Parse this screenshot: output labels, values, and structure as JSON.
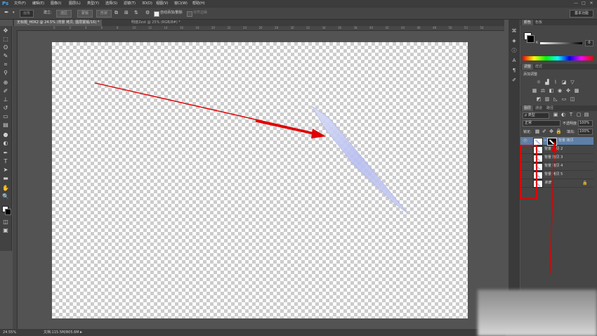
{
  "app": {
    "logo": "Ps"
  },
  "menu": [
    "文件(F)",
    "编辑(E)",
    "图像(I)",
    "图层(L)",
    "类型(Y)",
    "选择(S)",
    "滤镜(T)",
    "3D(D)",
    "视图(V)",
    "窗口(W)",
    "帮助(H)"
  ],
  "window_controls": [
    "—",
    "□",
    "✕"
  ],
  "options": {
    "value_box": "画板",
    "align_label": "建立:",
    "btn_selection": "选区",
    "btn_mask": "蒙版",
    "btn_shape": "形状",
    "auto_add_delete": "自动添加/删除",
    "align_edges": "对齐边缘",
    "workspace": "基本功能"
  },
  "document": {
    "tab_active": "无标题_H0K2 @ 24.5% (背景 拷贝, 图层蒙版/16) *",
    "tab_inactive": "明度Zest @ 25% (RGB/8#) *",
    "ruler_ticks": [
      "0",
      "2",
      "4",
      "6",
      "8",
      "10",
      "12",
      "14",
      "16",
      "18",
      "20",
      "22",
      "24",
      "26",
      "28",
      "30",
      "32",
      "34",
      "36",
      "38",
      "40",
      "42",
      "44",
      "46",
      "48",
      "50",
      "52",
      "54"
    ]
  },
  "status": {
    "zoom": "24.55%",
    "doc_info": "文档:115.5M/805.6M"
  },
  "color_panel": {
    "tabs": [
      "颜色",
      "色板"
    ],
    "slider_label": "K",
    "slider_value": "0"
  },
  "adjust_panel": {
    "tabs": [
      "调整",
      "样式"
    ],
    "heading": "添加调整"
  },
  "layers_panel": {
    "tabs": [
      "图层",
      "通道",
      "路径"
    ],
    "filter_kind": "ρ 类型",
    "blend_mode": "正常",
    "opacity_label": "不透明度:",
    "opacity_value": "100%",
    "lock_label": "锁定:",
    "fill_label": "填充:",
    "fill_value": "100%",
    "layers": [
      {
        "name": "背景 拷贝",
        "visible": true,
        "selected": true,
        "mask": true
      },
      {
        "name": "背景 拷贝 2",
        "visible": false,
        "selected": false,
        "mask": false
      },
      {
        "name": "背景 拷贝 3",
        "visible": false,
        "selected": false,
        "mask": false
      },
      {
        "name": "背景 拷贝 4",
        "visible": false,
        "selected": false,
        "mask": false
      },
      {
        "name": "背景 拷贝 5",
        "visible": false,
        "selected": false,
        "mask": false
      },
      {
        "name": "背景",
        "visible": false,
        "selected": false,
        "mask": false,
        "locked": true
      }
    ]
  },
  "colors": {
    "annotation": "#e00000",
    "selected_layer": "#5d7fa8",
    "accent": "#4aa3e8"
  }
}
